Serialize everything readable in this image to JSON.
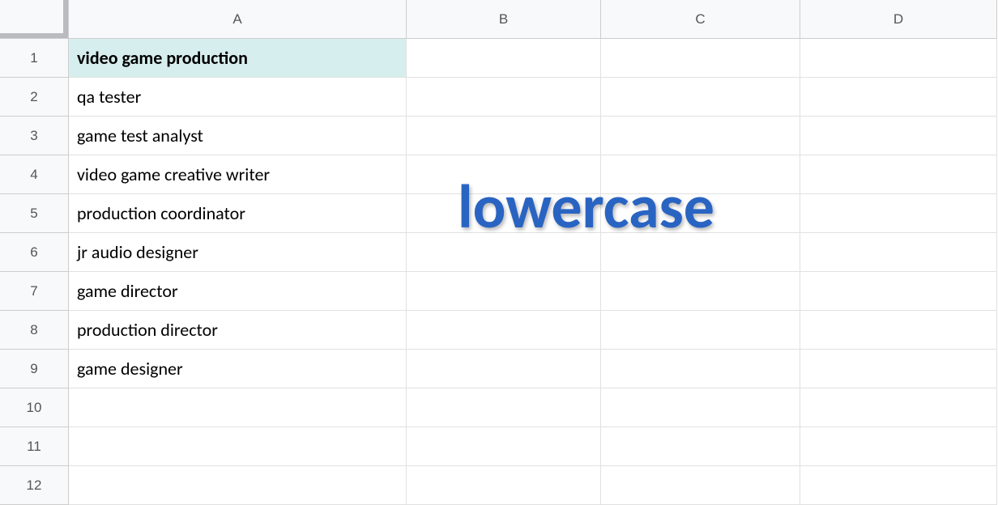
{
  "columns": [
    "A",
    "B",
    "C",
    "D"
  ],
  "row_count": 12,
  "cells": {
    "A1": "video game production",
    "A2": "qa tester",
    "A3": "game test analyst",
    "A4": "video game creative writer",
    "A5": "production coordinator",
    "A6": "jr audio designer",
    "A7": "game director",
    "A8": "production director",
    "A9": "game designer"
  },
  "overlay": "lowercase"
}
